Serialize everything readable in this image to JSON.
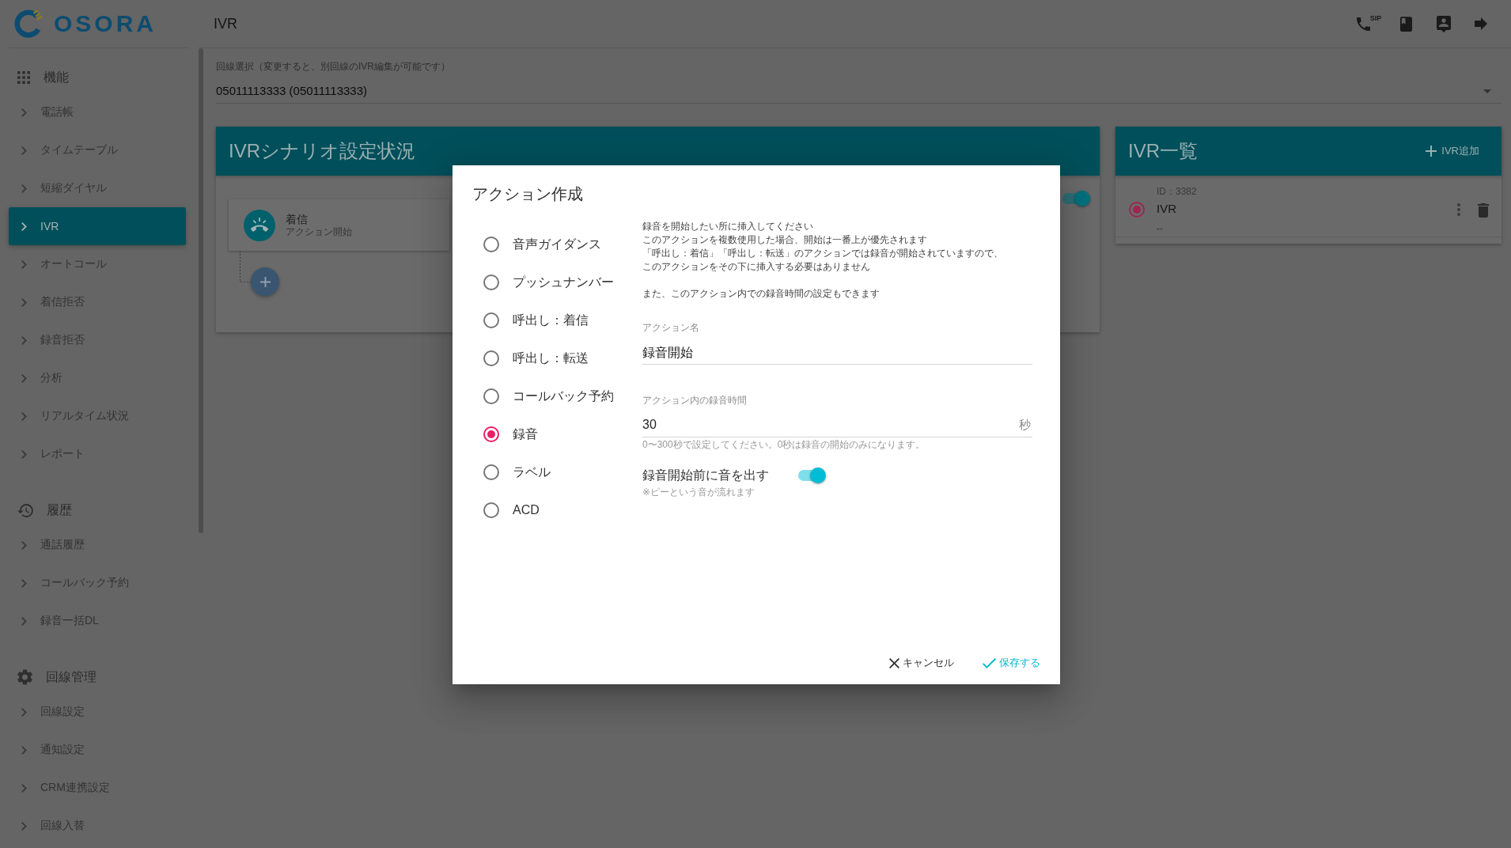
{
  "sidebar": {
    "logo_text": "OSORA",
    "groups": [
      {
        "kind": "apps",
        "title": "機能",
        "items": [
          {
            "label": "電話帳",
            "selected": false
          },
          {
            "label": "タイムテーブル",
            "selected": false
          },
          {
            "label": "短縮ダイヤル",
            "selected": false
          },
          {
            "label": "IVR",
            "selected": true
          },
          {
            "label": "オートコール",
            "selected": false
          },
          {
            "label": "着信拒否",
            "selected": false
          },
          {
            "label": "録音拒否",
            "selected": false
          },
          {
            "label": "分析",
            "selected": false
          },
          {
            "label": "リアルタイム状況",
            "selected": false
          },
          {
            "label": "レポート",
            "selected": false
          }
        ]
      },
      {
        "kind": "history",
        "title": "履歴",
        "items": [
          {
            "label": "通話履歴",
            "selected": false
          },
          {
            "label": "コールバック予約",
            "selected": false
          },
          {
            "label": "録音一括DL",
            "selected": false
          }
        ]
      },
      {
        "kind": "settings",
        "title": "回線管理",
        "items": [
          {
            "label": "回線設定",
            "selected": false
          },
          {
            "label": "通知設定",
            "selected": false
          },
          {
            "label": "CRM連携設定",
            "selected": false
          },
          {
            "label": "回線入替",
            "selected": false
          }
        ]
      }
    ]
  },
  "header": {
    "title": "IVR",
    "sip_label": "SIP"
  },
  "line_select": {
    "label": "回線選択（変更すると、別回線のIVR編集が可能です）",
    "value": "05011113333 (05011113333)"
  },
  "scenario_panel": {
    "title": "IVRシナリオ設定状況",
    "enabled": true,
    "nodes": [
      {
        "title": "着信",
        "subtitle": "アクション開始"
      }
    ]
  },
  "ivr_list": {
    "title": "IVR一覧",
    "add_label": "IVR追加",
    "items": [
      {
        "id": "ID：3382",
        "name": "IVR",
        "description": "--",
        "selected": true
      }
    ]
  },
  "dialog": {
    "title": "アクション作成",
    "action_types": [
      {
        "label": "音声ガイダンス",
        "selected": false
      },
      {
        "label": "プッシュナンバー",
        "selected": false
      },
      {
        "label": "呼出し：着信",
        "selected": false
      },
      {
        "label": "呼出し：転送",
        "selected": false
      },
      {
        "label": "コールバック予約",
        "selected": false
      },
      {
        "label": "録音",
        "selected": true
      },
      {
        "label": "ラベル",
        "selected": false
      },
      {
        "label": "ACD",
        "selected": false
      }
    ],
    "description": [
      [
        "録音を開始したい所に挿入してください",
        "このアクションを複数使用した場合、開始は一番上が優先されます",
        "「呼出し：着信」「呼出し：転送」のアクションでは録音が開始されていますので、",
        "このアクションをその下に挿入する必要はありません"
      ],
      [
        "また、このアクション内での録音時間の設定もできます"
      ]
    ],
    "fields": [
      {
        "kind": "text",
        "label": "アクション名",
        "value": "録音開始"
      },
      {
        "kind": "number",
        "label": "アクション内の録音時間",
        "value": "30",
        "suffix": "秒",
        "hint": "0〜300秒で設定してください。0秒は録音の開始のみになります。"
      }
    ],
    "beep": {
      "label": "録音開始前に音を出す",
      "on": true,
      "hint": "※ピーという音が流れます"
    },
    "buttons": [
      {
        "kind": "cancel",
        "label": "キャンセル"
      },
      {
        "kind": "save",
        "label": "保存する"
      }
    ]
  }
}
